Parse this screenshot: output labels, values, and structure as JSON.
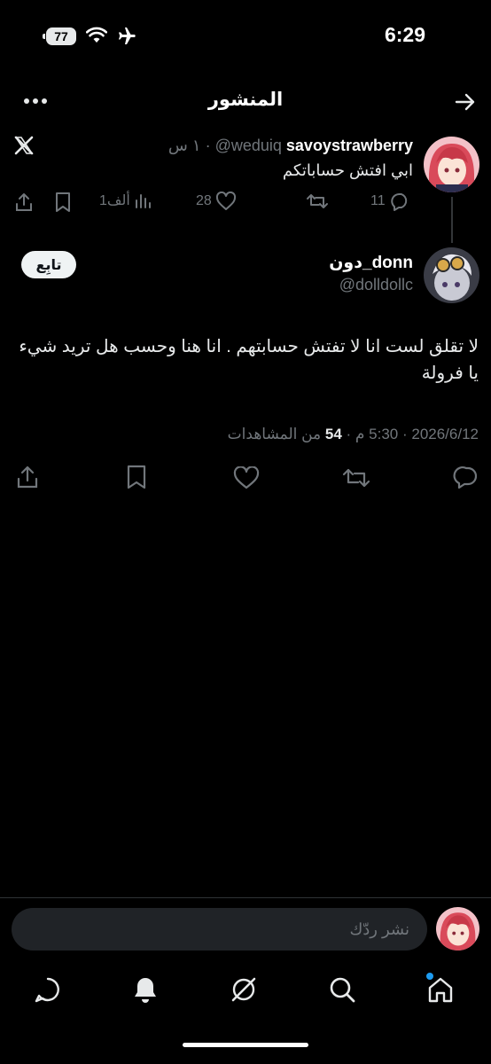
{
  "status_bar": {
    "time": "6:29",
    "battery": "77",
    "icons": [
      "battery-icon",
      "wifi-icon",
      "airplane-icon"
    ]
  },
  "header": {
    "title": "المنشور",
    "back_icon": "arrow-right-icon",
    "more_icon": "more-dots-icon"
  },
  "parent_tweet": {
    "display_name": "savoystrawberry",
    "handle": "@weduiq",
    "time": "١ س",
    "text": "ابي افتش حساباتكم",
    "badge_icon": "x-logo-icon",
    "stats": {
      "replies": "11",
      "likes": "28",
      "views": "1ألف"
    }
  },
  "main_tweet": {
    "display_name": "دون_donn",
    "handle": "@dolldollc",
    "follow_label": "تابِع",
    "text": "لا تقلق لست انا لا تفتش حسابتهم . انا هنا وحسب هل تريد شيء يا فرولة",
    "date": "2026/6/12",
    "time": "5:30 م",
    "views_count": "54",
    "views_label": "من المشاهدات"
  },
  "reply_bar": {
    "placeholder": "نشر ردّك"
  },
  "bottom_nav": {
    "items": [
      "home-icon",
      "search-icon",
      "grok-icon",
      "notifications-icon",
      "messages-icon"
    ]
  },
  "colors": {
    "background": "#000000",
    "text": "#e7e9ea",
    "muted": "#71767b",
    "accent": "#1d9bf0"
  }
}
